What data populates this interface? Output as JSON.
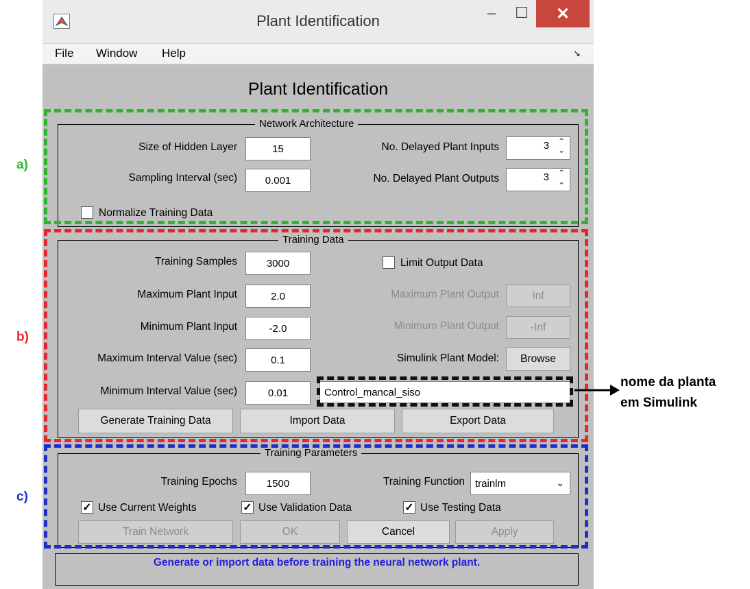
{
  "window": {
    "title": "Plant Identification"
  },
  "menu": {
    "file": "File",
    "window": "Window",
    "help": "Help"
  },
  "main_title": "Plant Identification",
  "architecture": {
    "title": "Network Architecture",
    "hidden_layer_label": "Size of Hidden Layer",
    "hidden_layer_value": "15",
    "sampling_label": "Sampling Interval (sec)",
    "sampling_value": "0.001",
    "delayed_inputs_label": "No. Delayed Plant Inputs",
    "delayed_inputs_value": "3",
    "delayed_outputs_label": "No. Delayed Plant Outputs",
    "delayed_outputs_value": "3",
    "normalize_label": "Normalize Training Data",
    "normalize_checked": false
  },
  "training_data": {
    "title": "Training Data",
    "samples_label": "Training Samples",
    "samples_value": "3000",
    "max_input_label": "Maximum Plant Input",
    "max_input_value": "2.0",
    "min_input_label": "Minimum Plant Input",
    "min_input_value": "-2.0",
    "max_interval_label": "Maximum Interval Value (sec)",
    "max_interval_value": "0.1",
    "min_interval_label": "Minimum Interval Value (sec)",
    "min_interval_value": "0.01",
    "limit_output_label": "Limit Output Data",
    "max_output_label": "Maximum Plant Output",
    "max_output_value": "Inf",
    "min_output_label": "Minimum Plant Output",
    "min_output_value": "-Inf",
    "simulink_label": "Simulink Plant Model:",
    "browse_label": "Browse",
    "model_name": "Control_mancal_siso",
    "generate_label": "Generate Training Data",
    "import_label": "Import Data",
    "export_label": "Export Data"
  },
  "training_params": {
    "title": "Training Parameters",
    "epochs_label": "Training Epochs",
    "epochs_value": "1500",
    "function_label": "Training Function",
    "function_value": "trainlm",
    "current_weights_label": "Use Current Weights",
    "validation_label": "Use Validation Data",
    "testing_label": "Use Testing Data",
    "train_label": "Train Network",
    "ok_label": "OK",
    "cancel_label": "Cancel",
    "apply_label": "Apply"
  },
  "status_text": "Generate or import data before training the neural network plant.",
  "annotations": {
    "a": "a)",
    "b": "b)",
    "c": "c)",
    "note_line1": "nome da planta",
    "note_line2": "em Simulink"
  },
  "colors": {
    "green": "#2db52d",
    "red": "#e8262b",
    "blue": "#1c2fc9",
    "status_blue": "#1f1fdc"
  }
}
